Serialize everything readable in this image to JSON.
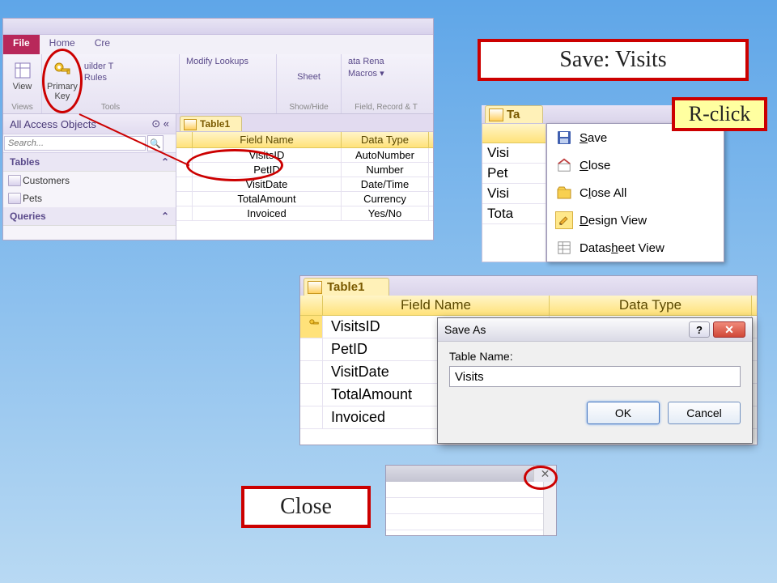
{
  "annotations": {
    "primary_key": "Primary Key",
    "save_visits": "Save: Visits",
    "r_click": "R-click",
    "close": "Close"
  },
  "win1": {
    "tabs": {
      "file": "File",
      "home": "Home",
      "create": "Cre"
    },
    "ribbon": {
      "views_label": "Views",
      "view_btn": "View",
      "primary_key_btn": "Primary\nKey",
      "builder": "uilder T",
      "rules": "Rules",
      "tools_label": "Tools",
      "modify_lookups": "Modify Lookups",
      "sheet": "Sheet",
      "showhide": "Show/Hide",
      "ata_rena": "ata Rena",
      "macros": "Macros ▾",
      "frt_label": "Field, Record & T"
    },
    "nav": {
      "header": "All Access Objects",
      "search_placeholder": "Search...",
      "cat_tables": "Tables",
      "item_customers": "Customers",
      "item_pets": "Pets",
      "cat_queries": "Queries"
    },
    "table": {
      "tab": "Table1",
      "col_fieldname": "Field Name",
      "col_datatype": "Data Type",
      "rows": [
        {
          "name": "VisitsID",
          "type": "AutoNumber"
        },
        {
          "name": "PetID",
          "type": "Number"
        },
        {
          "name": "VisitDate",
          "type": "Date/Time"
        },
        {
          "name": "TotalAmount",
          "type": "Currency"
        },
        {
          "name": "Invoiced",
          "type": "Yes/No"
        }
      ]
    }
  },
  "win2": {
    "tab": "Ta",
    "cells": [
      "Visi",
      "Pet",
      "Visi",
      "Tota"
    ],
    "menu": {
      "save": "Save",
      "close": "Close",
      "close_all": "Close All",
      "design_view": "Design View",
      "datasheet_view": "Datasheet View"
    }
  },
  "win3": {
    "tab": "Table1",
    "col_fieldname": "Field Name",
    "col_datatype": "Data Type",
    "rows": [
      "VisitsID",
      "PetID",
      "VisitDate",
      "TotalAmount",
      "Invoiced"
    ]
  },
  "dialog": {
    "title": "Save As",
    "label": "Table Name:",
    "value": "Visits",
    "ok": "OK",
    "cancel": "Cancel"
  }
}
